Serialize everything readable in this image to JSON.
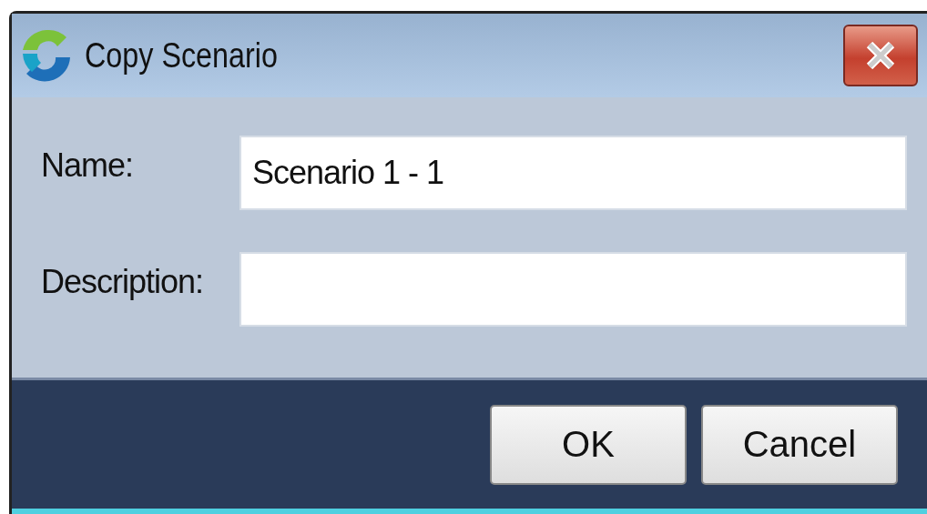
{
  "window": {
    "title": "Copy Scenario"
  },
  "fields": [
    {
      "label": "Name:",
      "value": "Scenario 1 - 1"
    },
    {
      "label": "Description:"
    }
  ],
  "buttons": [
    {
      "label": "OK"
    },
    {
      "label": "Cancel"
    }
  ]
}
